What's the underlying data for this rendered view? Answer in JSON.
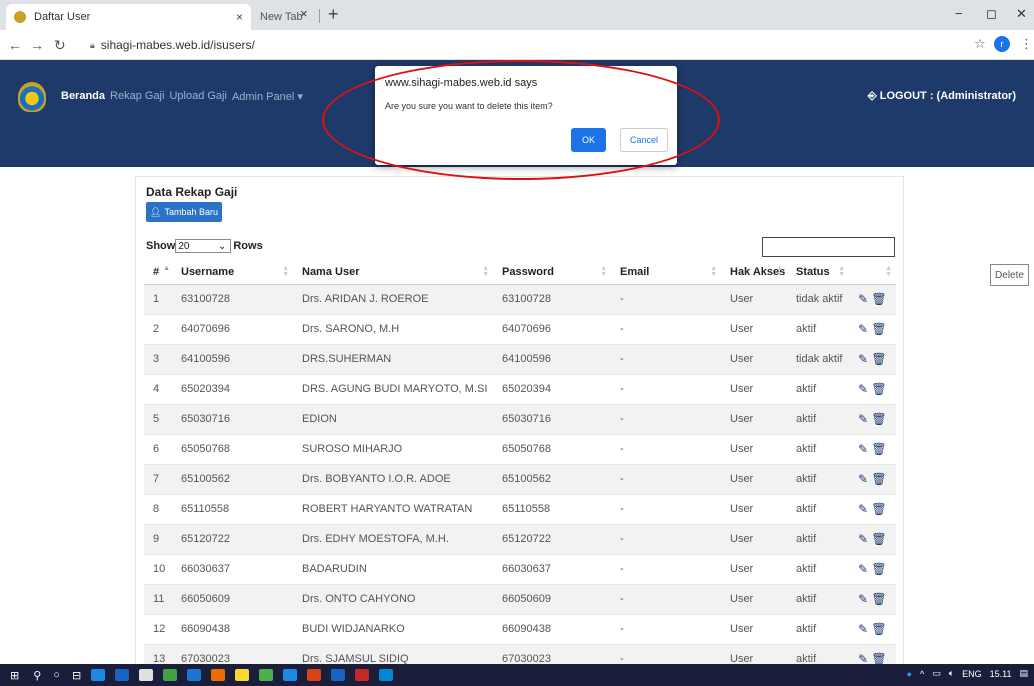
{
  "browser": {
    "tabs": [
      {
        "title": "Daftar User",
        "close": "×"
      },
      {
        "title": "New Tab",
        "close": "×"
      }
    ],
    "new_tab": "+",
    "url": "sihagi-mabes.web.id/isusers/",
    "profile_initial": "r",
    "window_controls": [
      "−",
      "◻",
      "✕"
    ]
  },
  "navbar": {
    "brand": "Beranda",
    "menu": [
      "Rekap Gaji",
      "Upload Gaji",
      "Admin Panel ▾"
    ],
    "logout": "LOGOUT : (Administrator)"
  },
  "card": {
    "title": "Data Rekap Gaji",
    "add_button": "Tambah Baru",
    "show_label": "Show",
    "show_value": "20",
    "rows_label": "Rows"
  },
  "table": {
    "columns": [
      "#",
      "Username",
      "Nama User",
      "Password",
      "Email",
      "Hak Akses",
      "Status",
      ""
    ],
    "rows": [
      [
        "1",
        "63100728",
        "Drs. ARIDAN J. ROEROE",
        "63100728",
        "-",
        "User",
        "tidak aktif"
      ],
      [
        "2",
        "64070696",
        "Drs. SARONO, M.H",
        "64070696",
        "-",
        "User",
        "aktif"
      ],
      [
        "3",
        "64100596",
        "DRS.SUHERMAN",
        "64100596",
        "-",
        "User",
        "tidak aktif"
      ],
      [
        "4",
        "65020394",
        "DRS. AGUNG BUDI MARYOTO, M.SI",
        "65020394",
        "-",
        "User",
        "aktif"
      ],
      [
        "5",
        "65030716",
        "EDION",
        "65030716",
        "-",
        "User",
        "aktif"
      ],
      [
        "6",
        "65050768",
        "SUROSO MIHARJO",
        "65050768",
        "-",
        "User",
        "aktif"
      ],
      [
        "7",
        "65100562",
        "Drs. BOBYANTO I.O.R. ADOE",
        "65100562",
        "-",
        "User",
        "aktif"
      ],
      [
        "8",
        "65110558",
        "ROBERT HARYANTO WATRATAN",
        "65110558",
        "-",
        "User",
        "aktif"
      ],
      [
        "9",
        "65120722",
        "Drs. EDHY MOESTOFA, M.H.",
        "65120722",
        "-",
        "User",
        "aktif"
      ],
      [
        "10",
        "66030637",
        "BADARUDIN",
        "66030637",
        "-",
        "User",
        "aktif"
      ],
      [
        "11",
        "66050609",
        "Drs. ONTO CAHYONO",
        "66050609",
        "-",
        "User",
        "aktif"
      ],
      [
        "12",
        "66090438",
        "BUDI WIDJANARKO",
        "66090438",
        "-",
        "User",
        "aktif"
      ],
      [
        "13",
        "67030023",
        "Drs. SJAMSUL SIDIQ",
        "67030023",
        "-",
        "User",
        "aktif"
      ]
    ]
  },
  "tooltip": "Delete",
  "dialog": {
    "title": "www.sihagi-mabes.web.id says",
    "message": "Are you sure you want to delete this item?",
    "ok": "OK",
    "cancel": "Cancel"
  },
  "taskbar": {
    "lang": "ENG",
    "time": "15.11"
  },
  "colors": {
    "navbar": "#1d3a6b",
    "primary": "#2a73c8",
    "dialog_button": "#1a73e8",
    "annotation": "#e01010"
  }
}
